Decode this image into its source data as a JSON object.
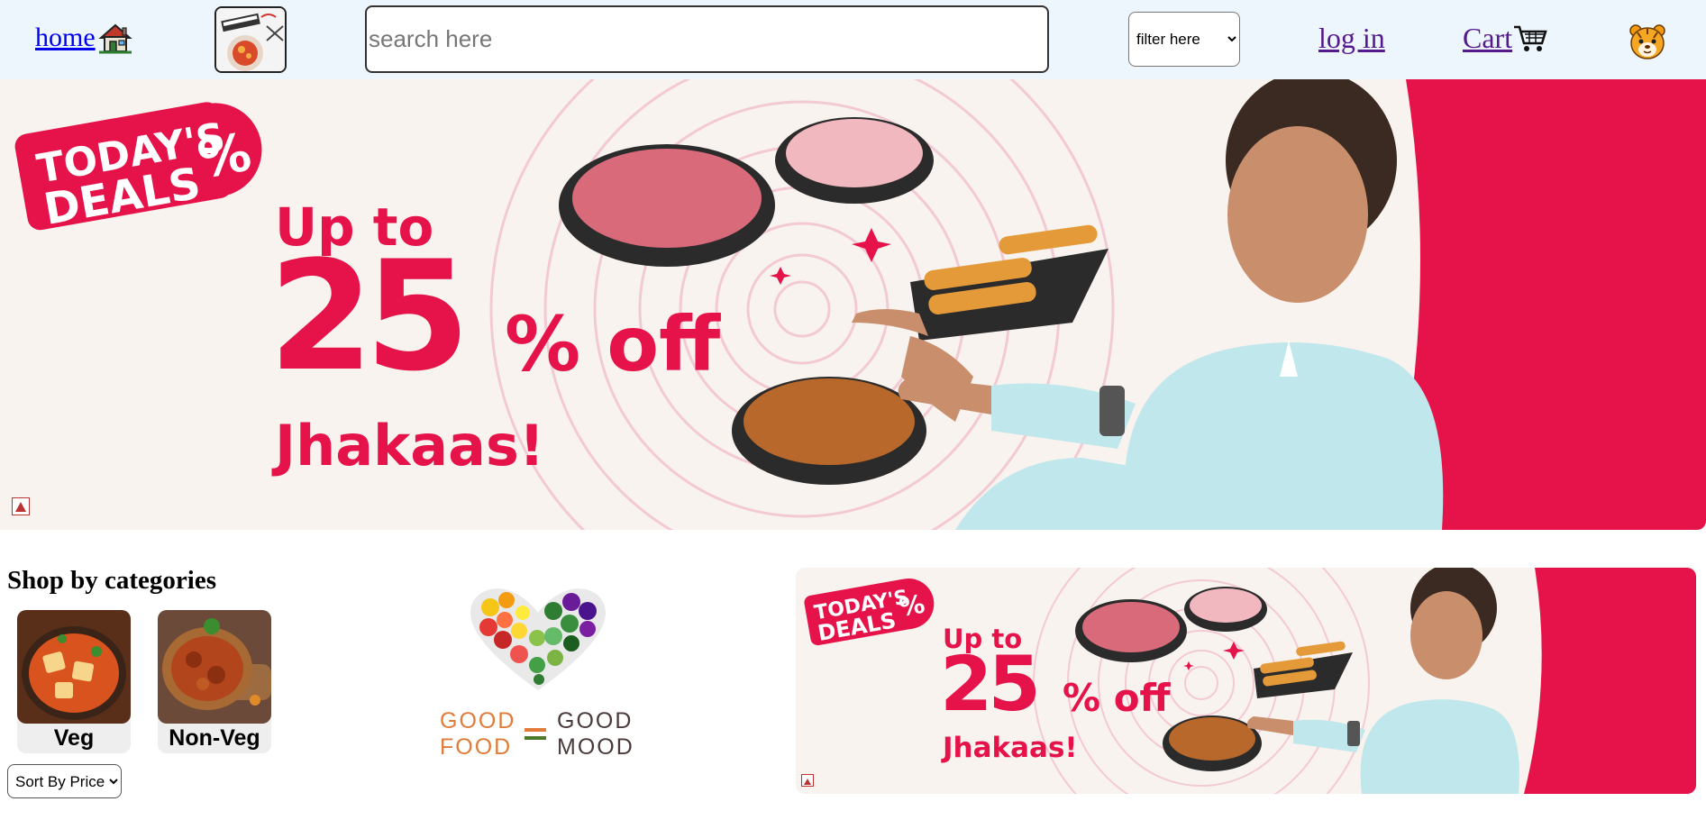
{
  "header": {
    "home_label": "home",
    "search_placeholder": "search here",
    "filter": {
      "selected": "filter here"
    },
    "login_label": "log in",
    "cart_label": "Cart"
  },
  "banner": {
    "badge_line1": "TODAY'S",
    "badge_line2": "DEALS",
    "badge_symbol": "%",
    "headline_upto": "Up to",
    "headline_number": "25",
    "headline_off": "% off",
    "headline_tag": "Jhakaas!"
  },
  "categories": {
    "title": "Shop by categories",
    "items": [
      {
        "label": "Veg"
      },
      {
        "label": "Non-Veg"
      }
    ],
    "sort": {
      "selected": "Sort By Price"
    }
  },
  "mood": {
    "left_line1": "GOOD",
    "left_line2": "FOOD",
    "right_line1": "GOOD",
    "right_line2": "MOOD"
  },
  "colors": {
    "header_bg": "#eef6fd",
    "brand_red": "#e5134a",
    "banner_bg": "#f8f3ee",
    "jacket": "#bfe7ec"
  }
}
